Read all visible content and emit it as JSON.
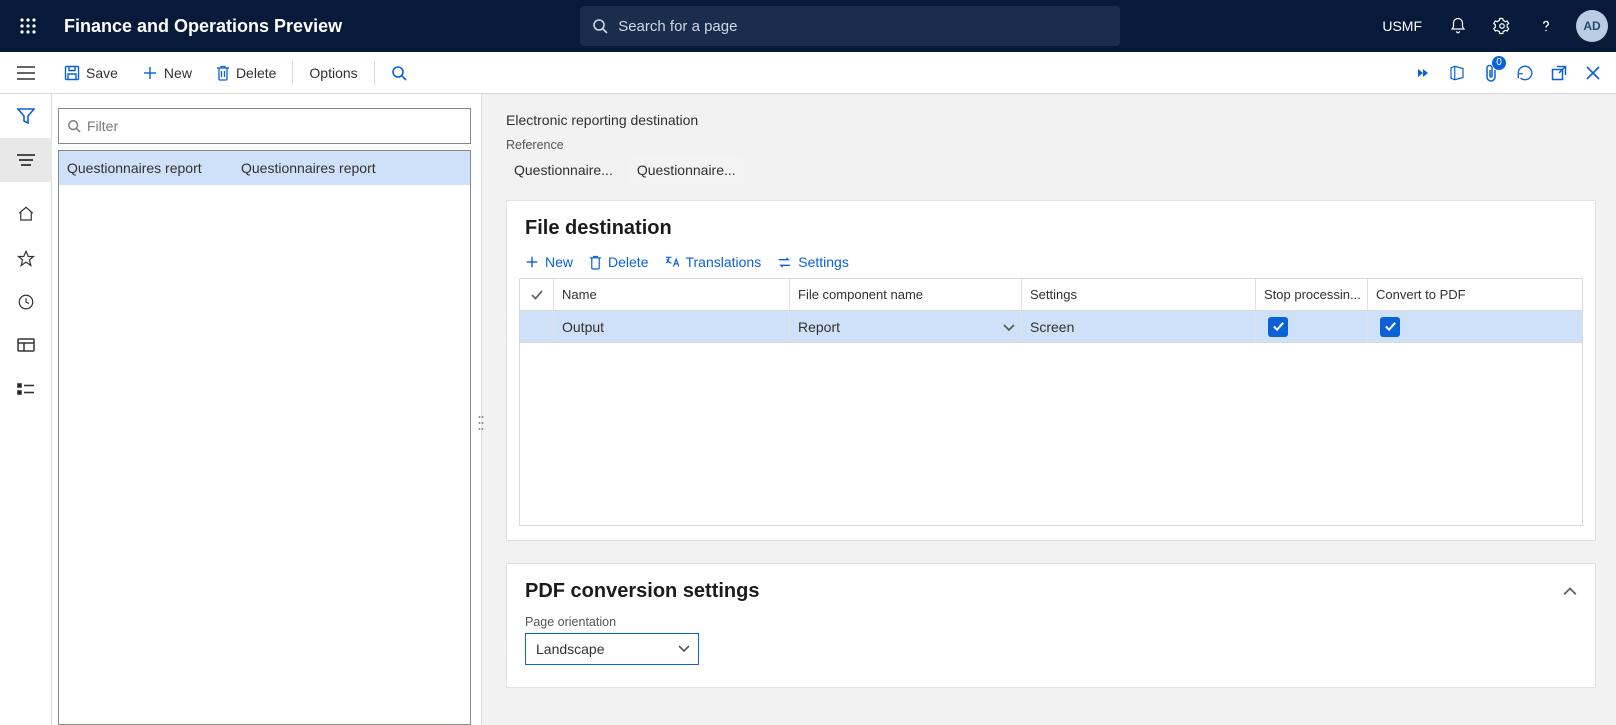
{
  "header": {
    "app_title": "Finance and Operations Preview",
    "search_placeholder": "Search for a page",
    "company": "USMF",
    "user_initials": "AD"
  },
  "action_bar": {
    "save": "Save",
    "new": "New",
    "delete": "Delete",
    "options": "Options",
    "attachments_badge": "0"
  },
  "list": {
    "filter_placeholder": "Filter",
    "rows": [
      {
        "c1": "Questionnaires report",
        "c2": "Questionnaires report",
        "selected": true
      }
    ]
  },
  "detail": {
    "page_title": "Electronic reporting destination",
    "reference_label": "Reference",
    "reference_chips": [
      "Questionnaire...",
      "Questionnaire..."
    ],
    "file_dest": {
      "title": "File destination",
      "toolbar": {
        "new": "New",
        "delete": "Delete",
        "translations": "Translations",
        "settings": "Settings"
      },
      "columns": {
        "name": "Name",
        "file_component": "File component name",
        "settings": "Settings",
        "stop": "Stop processin...",
        "convert": "Convert to PDF"
      },
      "rows": [
        {
          "name": "Output",
          "file_component": "Report",
          "settings": "Screen",
          "stop": true,
          "convert": true
        }
      ]
    },
    "pdf": {
      "title": "PDF conversion settings",
      "orientation_label": "Page orientation",
      "orientation_value": "Landscape"
    }
  }
}
